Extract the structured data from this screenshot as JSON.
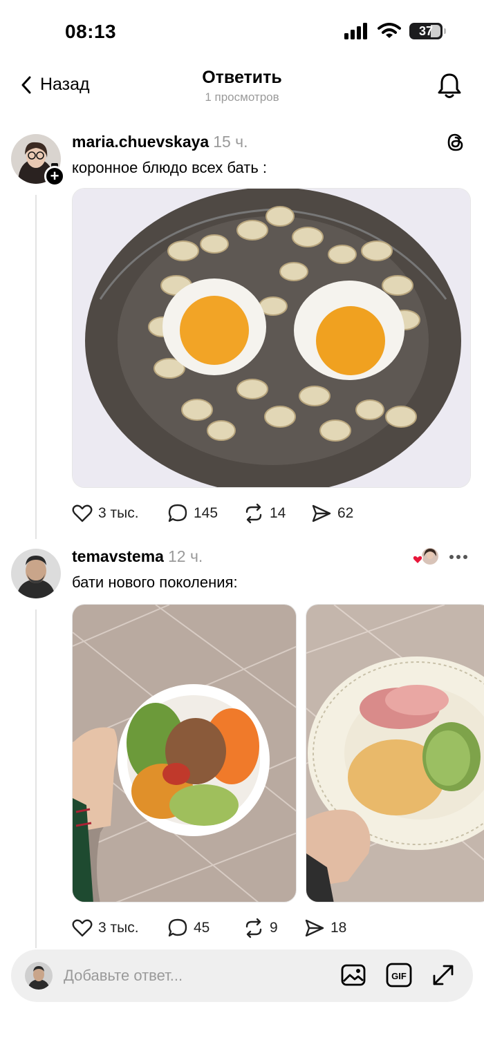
{
  "status": {
    "time": "08:13",
    "battery": "37"
  },
  "header": {
    "back_label": "Назад",
    "title": "Ответить",
    "subtitle": "1 просмотров"
  },
  "posts": [
    {
      "username": "maria.chuevskaya",
      "time": "15 ч.",
      "text": "коронное блюдо всех бать :",
      "likes": "3 тыс.",
      "comments": "145",
      "reposts": "14",
      "shares": "62"
    },
    {
      "username": "temavstema",
      "time": "12 ч.",
      "text": "бати нового поколения:",
      "likes": "3 тыс.",
      "comments": "45",
      "reposts": "9",
      "shares": "18"
    }
  ],
  "reply": {
    "placeholder": "Добавьте ответ...",
    "gif_label": "GIF"
  },
  "colors": {
    "heart_red": "#e8173a",
    "muted_text": "#9a9a9a",
    "reply_bg": "#efefef"
  }
}
